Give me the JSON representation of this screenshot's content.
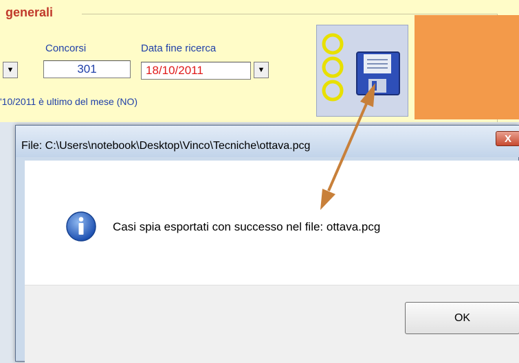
{
  "app": {
    "group_title": "generali",
    "concorsi_label": "Concorsi",
    "concorsi_value": "301",
    "datafine_label": "Data fine ricerca",
    "datafine_value": "18/10/2011",
    "info_line": "'10/2011 è ultimo del mese (NO)",
    "combo_arrow": "▼"
  },
  "dialog": {
    "title": "File: C:\\Users\\notebook\\Desktop\\Vinco\\Tecniche\\ottava.pcg",
    "close_label": "X",
    "message": "Casi spia esportati con successo nel file: ottava.pcg",
    "ok_label": "OK",
    "icon": "info-icon"
  },
  "colors": {
    "panel_bg": "#fffcc8",
    "orange_block": "#f39a4a",
    "label_blue": "#1f3fa8",
    "date_red": "#e01a1a",
    "arrow": "#c8803a"
  }
}
